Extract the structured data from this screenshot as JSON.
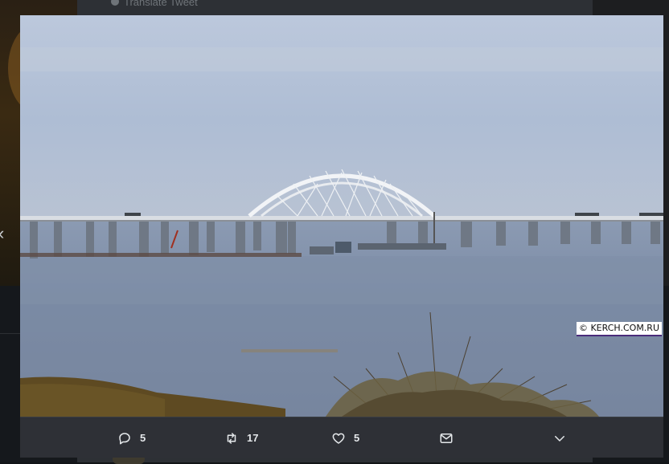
{
  "background": {
    "translate_label": "Translate Tweet",
    "prev_arrow": "‹"
  },
  "photo": {
    "subject": "Crimean (Kerch) bridge with arch over the strait",
    "watermark": "© KERCH.COM.RU"
  },
  "actions": {
    "reply": {
      "icon": "reply-icon",
      "count": "5"
    },
    "retweet": {
      "icon": "retweet-icon",
      "count": "17"
    },
    "like": {
      "icon": "heart-icon",
      "count": "5"
    },
    "direct_message": {
      "icon": "envelope-icon"
    },
    "more": {
      "icon": "chevron-down-icon"
    }
  },
  "colors": {
    "action_bar_bg": "#2e3036",
    "action_text": "#e4e7ea",
    "sky": "#a9b9d3",
    "water": "#7f8fa9"
  }
}
